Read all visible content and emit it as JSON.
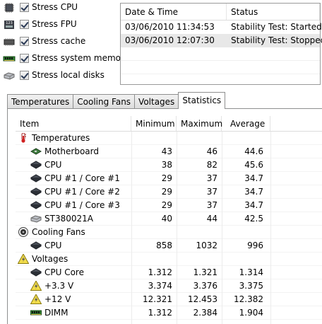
{
  "stress": [
    {
      "label": "Stress CPU",
      "icon": "cpu-icon",
      "checked": true
    },
    {
      "label": "Stress FPU",
      "icon": "fpu-icon",
      "checked": true
    },
    {
      "label": "Stress cache",
      "icon": "cache-icon",
      "checked": true
    },
    {
      "label": "Stress system memory",
      "icon": "memory-icon",
      "checked": true
    },
    {
      "label": "Stress local disks",
      "icon": "disk-icon",
      "checked": true
    }
  ],
  "fpu_icon_text": "123",
  "log": {
    "headers": {
      "date": "Date & Time",
      "status": "Status"
    },
    "rows": [
      {
        "date": "03/06/2010 11:34:53",
        "status": "Stability Test: Started"
      },
      {
        "date": "03/06/2010 12:07:30",
        "status": "Stability Test: Stopped"
      }
    ]
  },
  "tabs": [
    {
      "label": "Temperatures",
      "active": false
    },
    {
      "label": "Cooling Fans",
      "active": false
    },
    {
      "label": "Voltages",
      "active": false
    },
    {
      "label": "Statistics",
      "active": true
    }
  ],
  "grid": {
    "headers": {
      "item": "Item",
      "min": "Minimum",
      "max": "Maximum",
      "avg": "Average"
    },
    "rows": [
      {
        "type": "cat",
        "label": "Temperatures",
        "icon": "thermometer-icon"
      },
      {
        "type": "sub",
        "label": "Motherboard",
        "icon": "motherboard-icon",
        "min": "43",
        "max": "46",
        "avg": "44.6"
      },
      {
        "type": "sub",
        "label": "CPU",
        "icon": "chip-icon",
        "min": "38",
        "max": "82",
        "avg": "45.6"
      },
      {
        "type": "sub",
        "label": "CPU #1 / Core #1",
        "icon": "chip-icon",
        "min": "29",
        "max": "37",
        "avg": "34.7"
      },
      {
        "type": "sub",
        "label": "CPU #1 / Core #2",
        "icon": "chip-icon",
        "min": "29",
        "max": "37",
        "avg": "34.7"
      },
      {
        "type": "sub",
        "label": "CPU #1 / Core #3",
        "icon": "chip-icon",
        "min": "29",
        "max": "37",
        "avg": "34.7"
      },
      {
        "type": "sub",
        "label": "ST380021A",
        "icon": "disk-icon",
        "min": "40",
        "max": "44",
        "avg": "42.5"
      },
      {
        "type": "cat",
        "label": "Cooling Fans",
        "icon": "fan-icon"
      },
      {
        "type": "sub",
        "label": "CPU",
        "icon": "chip-icon",
        "min": "858",
        "max": "1032",
        "avg": "996"
      },
      {
        "type": "cat",
        "label": "Voltages",
        "icon": "voltage-icon"
      },
      {
        "type": "sub",
        "label": "CPU Core",
        "icon": "chip-icon",
        "min": "1.312",
        "max": "1.321",
        "avg": "1.314"
      },
      {
        "type": "sub",
        "label": "+3.3 V",
        "icon": "voltage-icon",
        "min": "3.374",
        "max": "3.376",
        "avg": "3.375"
      },
      {
        "type": "sub",
        "label": "+12 V",
        "icon": "voltage-icon",
        "min": "12.321",
        "max": "12.453",
        "avg": "12.382"
      },
      {
        "type": "sub",
        "label": "DIMM",
        "icon": "memory-icon",
        "min": "1.312",
        "max": "2.384",
        "avg": "1.904"
      }
    ]
  }
}
